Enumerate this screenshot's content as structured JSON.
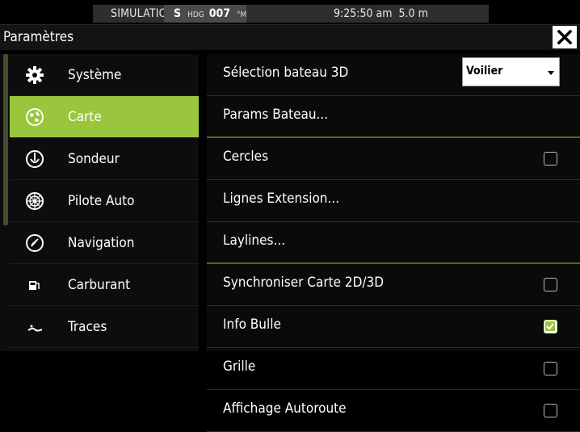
{
  "status": {
    "simulation": "SIMULATION...",
    "heading_prefix": "S",
    "heading_label": "HDG",
    "heading_value": "007",
    "heading_unit": "°M",
    "time": "9:25:50 am",
    "depth": "5.0 m"
  },
  "header": {
    "title": "Paramètres"
  },
  "sidebar": {
    "items": [
      {
        "label": "Système",
        "icon": "gear-icon"
      },
      {
        "label": "Carte",
        "icon": "chart-globe-icon",
        "active": true
      },
      {
        "label": "Sondeur",
        "icon": "sonar-icon"
      },
      {
        "label": "Pilote Auto",
        "icon": "autopilot-wheel-icon"
      },
      {
        "label": "Navigation",
        "icon": "compass-icon"
      },
      {
        "label": "Carburant",
        "icon": "fuel-pump-icon"
      },
      {
        "label": "Traces",
        "icon": "track-icon"
      }
    ]
  },
  "main": {
    "rows": [
      {
        "label": "Sélection bateau 3D",
        "control": "select",
        "value": "Voilier"
      },
      {
        "label": "Params Bateau..."
      },
      {
        "label": "Cercles",
        "control": "checkbox",
        "checked": false
      },
      {
        "label": "Lignes Extension..."
      },
      {
        "label": "Laylines..."
      },
      {
        "label": "Synchroniser Carte 2D/3D",
        "control": "checkbox",
        "checked": false
      },
      {
        "label": "Info Bulle",
        "control": "checkbox",
        "checked": true
      },
      {
        "label": "Grille",
        "control": "checkbox",
        "checked": false
      },
      {
        "label": "Affichage Autoroute",
        "control": "checkbox",
        "checked": false
      }
    ]
  },
  "colors": {
    "accent": "#9bc53d",
    "background": "#000000"
  }
}
